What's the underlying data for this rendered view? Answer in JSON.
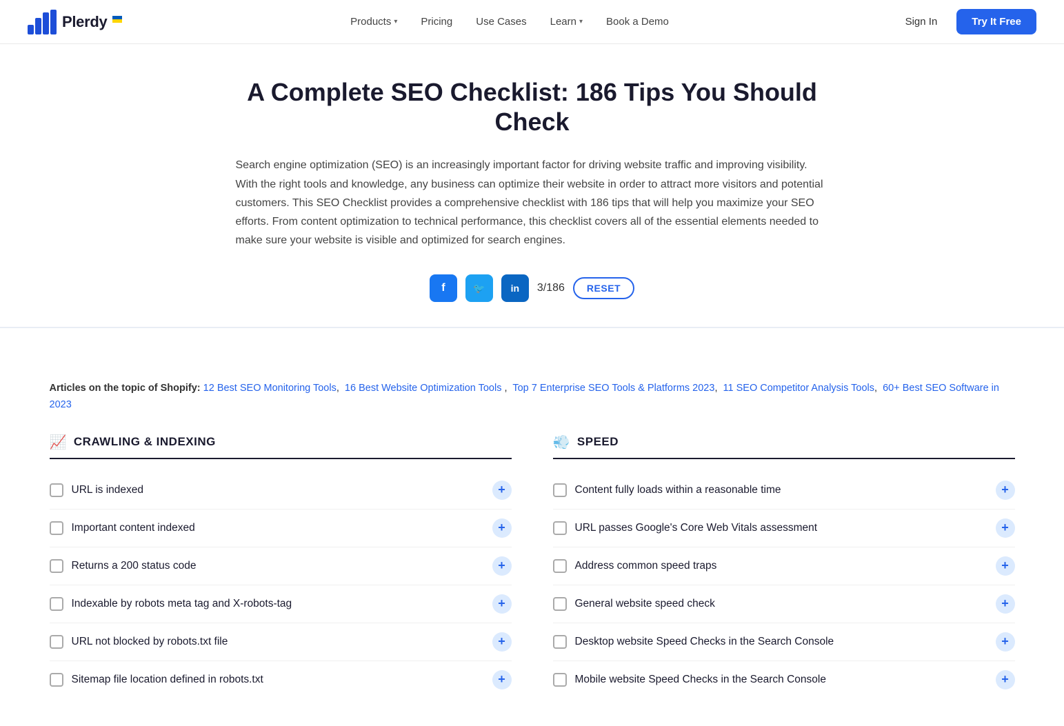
{
  "header": {
    "logo_text": "Plerdy",
    "nav_items": [
      {
        "label": "Products",
        "has_dropdown": true
      },
      {
        "label": "Pricing",
        "has_dropdown": false
      },
      {
        "label": "Use Cases",
        "has_dropdown": false
      },
      {
        "label": "Learn",
        "has_dropdown": true
      },
      {
        "label": "Book a Demo",
        "has_dropdown": false
      }
    ],
    "sign_in_label": "Sign In",
    "try_free_label": "Try It Free"
  },
  "main": {
    "title": "A Complete SEO Checklist: 186 Tips You Should Check",
    "description": "Search engine optimization (SEO) is an increasingly important factor for driving website traffic and improving visibility. With the right tools and knowledge, any business can optimize their website in order to attract more visitors and potential customers. This SEO Checklist provides a comprehensive checklist with 186 tips that will help you maximize your SEO efforts. From content optimization to technical performance, this checklist covers all of the essential elements needed to make sure your website is visible and optimized for search engines.",
    "counter": "3/186",
    "reset_label": "RESET",
    "articles_label": "Articles on the topic of Shopify:",
    "articles_links": [
      "12 Best SEO Monitoring Tools",
      "16 Best Website Optimization Tools",
      "Top 7 Enterprise SEO Tools & Platforms 2023",
      "11 SEO Competitor Analysis Tools",
      "60+ Best SEO Software in 2023"
    ]
  },
  "sections": [
    {
      "id": "crawling",
      "emoji": "📈",
      "title": "CRAWLING & INDEXING",
      "items": [
        "URL is indexed",
        "Important content indexed",
        "Returns a 200 status code",
        "Indexable by robots meta tag and X-robots-tag",
        "URL not blocked by robots.txt file",
        "Sitemap file location defined in robots.txt"
      ]
    },
    {
      "id": "speed",
      "emoji": "💨",
      "title": "SPEED",
      "items": [
        "Content fully loads within a reasonable time",
        "URL passes Google's Core Web Vitals assessment",
        "Address common speed traps",
        "General website speed check",
        "Desktop website Speed Checks in the Search Console",
        "Mobile website Speed Checks in the Search Console"
      ]
    }
  ],
  "social": {
    "facebook_label": "f",
    "twitter_label": "t",
    "linkedin_label": "in"
  }
}
